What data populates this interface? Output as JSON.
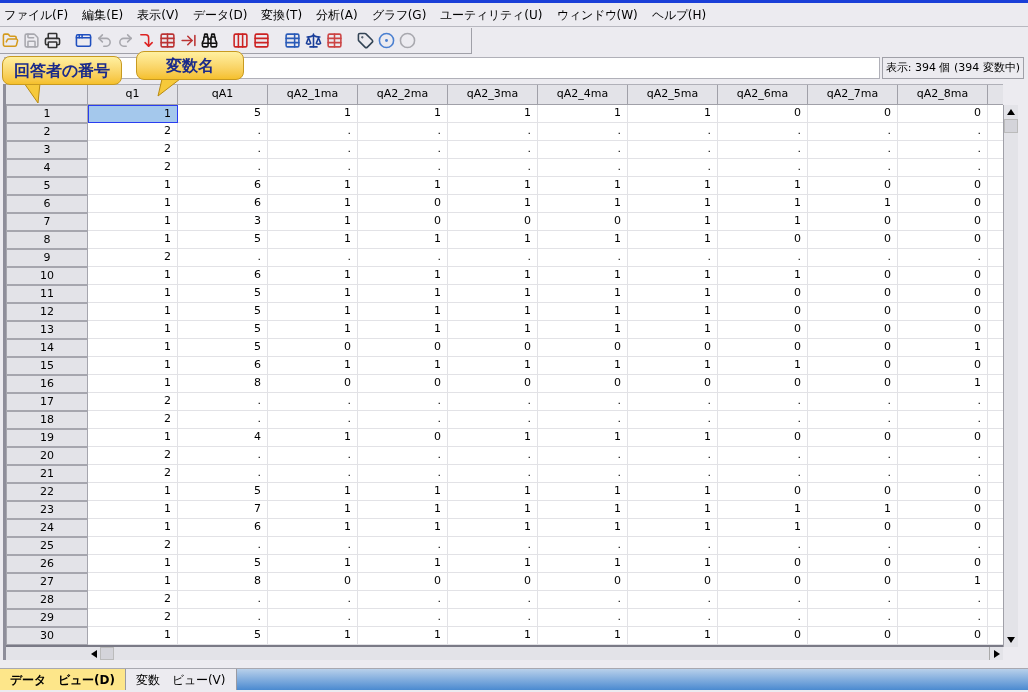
{
  "menu": [
    "ファイル(F)",
    "編集(E)",
    "表示(V)",
    "データ(D)",
    "変換(T)",
    "分析(A)",
    "グラフ(G)",
    "ユーティリティ(U)",
    "ウィンドウ(W)",
    "ヘルプ(H)"
  ],
  "toolbar": [
    [
      {
        "disabled": false
      },
      {
        "disabled": true
      },
      {
        "disabled": false
      }
    ],
    [
      {
        "disabled": false
      },
      {
        "disabled": true
      },
      {
        "disabled": true
      },
      {
        "disabled": false
      },
      {
        "disabled": false
      },
      {
        "disabled": false
      },
      {
        "disabled": false
      }
    ],
    [
      {
        "disabled": false
      },
      {
        "disabled": false
      }
    ],
    [
      {
        "disabled": false
      },
      {
        "disabled": false
      },
      {
        "disabled": false
      }
    ],
    [
      {
        "disabled": false
      },
      {
        "disabled": false
      },
      {
        "disabled": true
      }
    ]
  ],
  "callouts": [
    {
      "kind": "row",
      "text": "回答者の番号"
    },
    {
      "kind": "column",
      "text": "変数名"
    }
  ],
  "visible_count": "表示: 394 個 (394 変数中)",
  "table": {
    "columns": [
      "q1",
      "qA1",
      "qA2_1ma",
      "qA2_2ma",
      "qA2_3ma",
      "qA2_4ma",
      "qA2_5ma",
      "qA2_6ma",
      "qA2_7ma",
      "qA2_8ma"
    ],
    "rows": [
      {
        "number": "1",
        "selected": true,
        "cells": [
          "1",
          "5",
          "1",
          "1",
          "1",
          "1",
          "1",
          "0",
          "0",
          "0"
        ]
      },
      {
        "number": "2",
        "selected": false,
        "cells": [
          "2",
          ".",
          ".",
          ".",
          ".",
          ".",
          ".",
          ".",
          ".",
          "."
        ]
      },
      {
        "number": "3",
        "selected": false,
        "cells": [
          "2",
          ".",
          ".",
          ".",
          ".",
          ".",
          ".",
          ".",
          ".",
          "."
        ]
      },
      {
        "number": "4",
        "selected": false,
        "cells": [
          "2",
          ".",
          ".",
          ".",
          ".",
          ".",
          ".",
          ".",
          ".",
          "."
        ]
      },
      {
        "number": "5",
        "selected": false,
        "cells": [
          "1",
          "6",
          "1",
          "1",
          "1",
          "1",
          "1",
          "1",
          "0",
          "0"
        ]
      },
      {
        "number": "6",
        "selected": false,
        "cells": [
          "1",
          "6",
          "1",
          "0",
          "1",
          "1",
          "1",
          "1",
          "1",
          "0"
        ]
      },
      {
        "number": "7",
        "selected": false,
        "cells": [
          "1",
          "3",
          "1",
          "0",
          "0",
          "0",
          "1",
          "1",
          "0",
          "0"
        ]
      },
      {
        "number": "8",
        "selected": false,
        "cells": [
          "1",
          "5",
          "1",
          "1",
          "1",
          "1",
          "1",
          "0",
          "0",
          "0"
        ]
      },
      {
        "number": "9",
        "selected": false,
        "cells": [
          "2",
          ".",
          ".",
          ".",
          ".",
          ".",
          ".",
          ".",
          ".",
          "."
        ]
      },
      {
        "number": "10",
        "selected": false,
        "cells": [
          "1",
          "6",
          "1",
          "1",
          "1",
          "1",
          "1",
          "1",
          "0",
          "0"
        ]
      },
      {
        "number": "11",
        "selected": false,
        "cells": [
          "1",
          "5",
          "1",
          "1",
          "1",
          "1",
          "1",
          "0",
          "0",
          "0"
        ]
      },
      {
        "number": "12",
        "selected": false,
        "cells": [
          "1",
          "5",
          "1",
          "1",
          "1",
          "1",
          "1",
          "0",
          "0",
          "0"
        ]
      },
      {
        "number": "13",
        "selected": false,
        "cells": [
          "1",
          "5",
          "1",
          "1",
          "1",
          "1",
          "1",
          "0",
          "0",
          "0"
        ]
      },
      {
        "number": "14",
        "selected": false,
        "cells": [
          "1",
          "5",
          "0",
          "0",
          "0",
          "0",
          "0",
          "0",
          "0",
          "1"
        ]
      },
      {
        "number": "15",
        "selected": false,
        "cells": [
          "1",
          "6",
          "1",
          "1",
          "1",
          "1",
          "1",
          "1",
          "0",
          "0"
        ]
      },
      {
        "number": "16",
        "selected": false,
        "cells": [
          "1",
          "8",
          "0",
          "0",
          "0",
          "0",
          "0",
          "0",
          "0",
          "1"
        ]
      },
      {
        "number": "17",
        "selected": false,
        "cells": [
          "2",
          ".",
          ".",
          ".",
          ".",
          ".",
          ".",
          ".",
          ".",
          "."
        ]
      },
      {
        "number": "18",
        "selected": false,
        "cells": [
          "2",
          ".",
          ".",
          ".",
          ".",
          ".",
          ".",
          ".",
          ".",
          "."
        ]
      },
      {
        "number": "19",
        "selected": false,
        "cells": [
          "1",
          "4",
          "1",
          "0",
          "1",
          "1",
          "1",
          "0",
          "0",
          "0"
        ]
      },
      {
        "number": "20",
        "selected": false,
        "cells": [
          "2",
          ".",
          ".",
          ".",
          ".",
          ".",
          ".",
          ".",
          ".",
          "."
        ]
      },
      {
        "number": "21",
        "selected": false,
        "cells": [
          "2",
          ".",
          ".",
          ".",
          ".",
          ".",
          ".",
          ".",
          ".",
          "."
        ]
      },
      {
        "number": "22",
        "selected": false,
        "cells": [
          "1",
          "5",
          "1",
          "1",
          "1",
          "1",
          "1",
          "0",
          "0",
          "0"
        ]
      },
      {
        "number": "23",
        "selected": false,
        "cells": [
          "1",
          "7",
          "1",
          "1",
          "1",
          "1",
          "1",
          "1",
          "1",
          "0"
        ]
      },
      {
        "number": "24",
        "selected": false,
        "cells": [
          "1",
          "6",
          "1",
          "1",
          "1",
          "1",
          "1",
          "1",
          "0",
          "0"
        ]
      },
      {
        "number": "25",
        "selected": false,
        "cells": [
          "2",
          ".",
          ".",
          ".",
          ".",
          ".",
          ".",
          ".",
          ".",
          "."
        ]
      },
      {
        "number": "26",
        "selected": false,
        "cells": [
          "1",
          "5",
          "1",
          "1",
          "1",
          "1",
          "1",
          "0",
          "0",
          "0"
        ]
      },
      {
        "number": "27",
        "selected": false,
        "cells": [
          "1",
          "8",
          "0",
          "0",
          "0",
          "0",
          "0",
          "0",
          "0",
          "1"
        ]
      },
      {
        "number": "28",
        "selected": false,
        "cells": [
          "2",
          ".",
          ".",
          ".",
          ".",
          ".",
          ".",
          ".",
          ".",
          "."
        ]
      },
      {
        "number": "29",
        "selected": false,
        "cells": [
          "2",
          ".",
          ".",
          ".",
          ".",
          ".",
          ".",
          ".",
          ".",
          "."
        ]
      },
      {
        "number": "30",
        "selected": false,
        "cells": [
          "1",
          "5",
          "1",
          "1",
          "1",
          "1",
          "1",
          "0",
          "0",
          "0"
        ]
      }
    ]
  },
  "tabs": [
    {
      "label": "データ　ビュー(D)",
      "selected": true
    },
    {
      "label": "変数　ビュー(V)",
      "selected": false
    }
  ]
}
